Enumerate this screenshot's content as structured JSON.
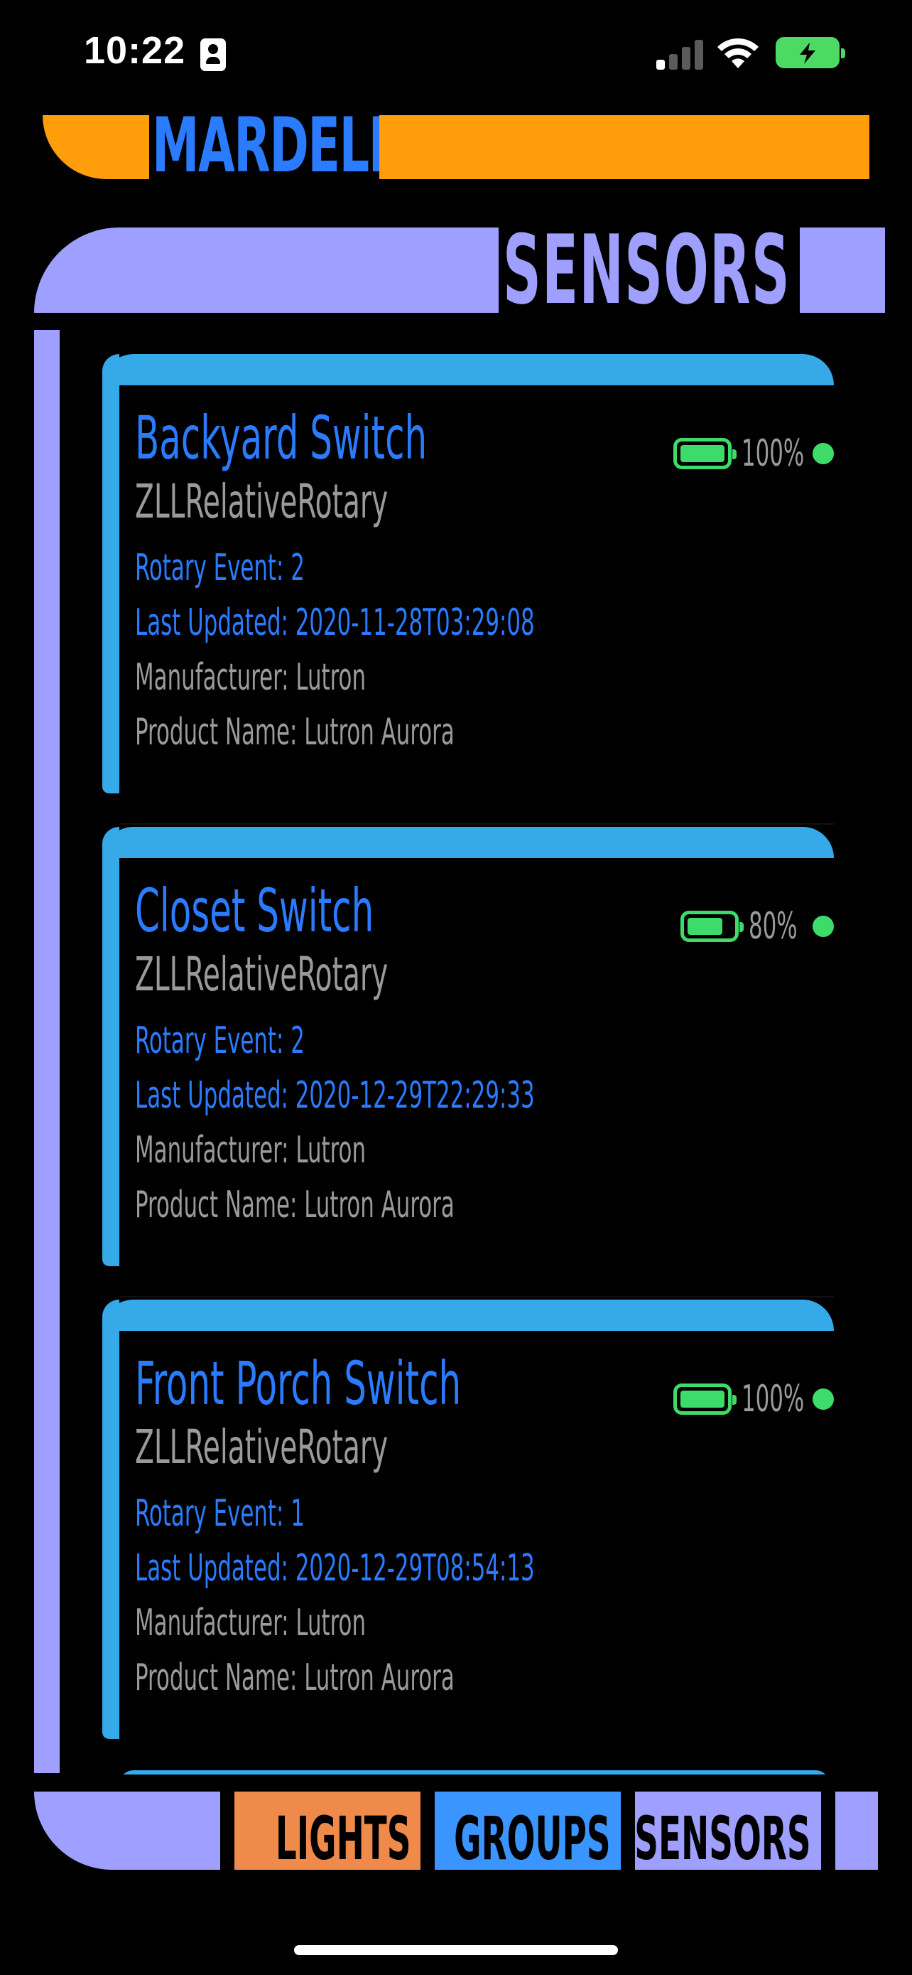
{
  "status_bar": {
    "time": "10:22"
  },
  "header": {
    "title": "MARDELL"
  },
  "section": {
    "title": "SENSORS"
  },
  "sensors": [
    {
      "name": "Backyard Switch",
      "type": "ZLLRelativeRotary",
      "rotary_event": "Rotary Event: 2",
      "last_updated": "Last Updated: 2020-11-28T03:29:08",
      "manufacturer": "Manufacturer:  Lutron",
      "product_name": "Product Name: Lutron Aurora",
      "battery": "100%",
      "battery_level": 1.0
    },
    {
      "name": "Closet Switch",
      "type": "ZLLRelativeRotary",
      "rotary_event": "Rotary Event: 2",
      "last_updated": "Last Updated: 2020-12-29T22:29:33",
      "manufacturer": "Manufacturer:  Lutron",
      "product_name": "Product Name: Lutron Aurora",
      "battery": "80%",
      "battery_level": 0.8
    },
    {
      "name": "Front Porch Switch",
      "type": "ZLLRelativeRotary",
      "rotary_event": "Rotary Event: 1",
      "last_updated": "Last Updated: 2020-12-29T08:54:13",
      "manufacturer": "Manufacturer:  Lutron",
      "product_name": "Product Name: Lutron Aurora",
      "battery": "100%",
      "battery_level": 1.0
    }
  ],
  "tabs": [
    {
      "label": "LIGHTS",
      "color": "#f08a4b"
    },
    {
      "label": "GROUPS",
      "color": "#3a95ff"
    },
    {
      "label": "SENSORS",
      "color": "#9f9fff"
    }
  ],
  "colors": {
    "orange": "#ff9d0b",
    "lavender": "#9f9fff",
    "blue": "#2b7bff",
    "cyan": "#36a9e8",
    "green": "#3ddc6a"
  }
}
